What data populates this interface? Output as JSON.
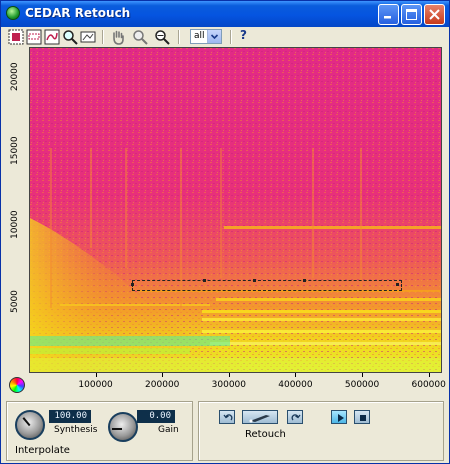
{
  "window": {
    "title": "CEDAR Retouch"
  },
  "toolbar": {
    "tools": [
      {
        "icon": "select-all-icon"
      },
      {
        "icon": "select-region-icon"
      },
      {
        "icon": "select-freehand-icon"
      },
      {
        "icon": "zoom-icon"
      },
      {
        "icon": "zoom-box-icon"
      },
      {
        "icon": "hand-icon"
      },
      {
        "icon": "zoom-in-icon"
      },
      {
        "icon": "zoom-out-icon"
      }
    ],
    "channel_select": "all",
    "help_label": "?"
  },
  "spectrogram": {
    "y_ticks": [
      "20000",
      "15000",
      "10000",
      "5000"
    ],
    "x_ticks": [
      "100000",
      "200000",
      "300000",
      "400000",
      "500000",
      "600000"
    ],
    "y_range": [
      0,
      22050
    ],
    "x_range": [
      0,
      620000
    ],
    "colors": {
      "background": "#e8307a",
      "mid": "#f26a3a",
      "high": "#f2c21a",
      "peak": "#d8f53a",
      "low_band": "#3af0b0"
    }
  },
  "interpolate": {
    "section_label": "Interpolate",
    "synthesis": {
      "value": "100.00",
      "label": "Synthesis"
    },
    "gain": {
      "value": "0.00",
      "label": "Gain"
    }
  },
  "retouch": {
    "label": "Retouch",
    "buttons": [
      {
        "icon": "undo-icon"
      },
      {
        "icon": "retouch-brush-icon"
      },
      {
        "icon": "redo-icon"
      },
      {
        "icon": "play-icon"
      },
      {
        "icon": "stop-icon"
      }
    ]
  }
}
